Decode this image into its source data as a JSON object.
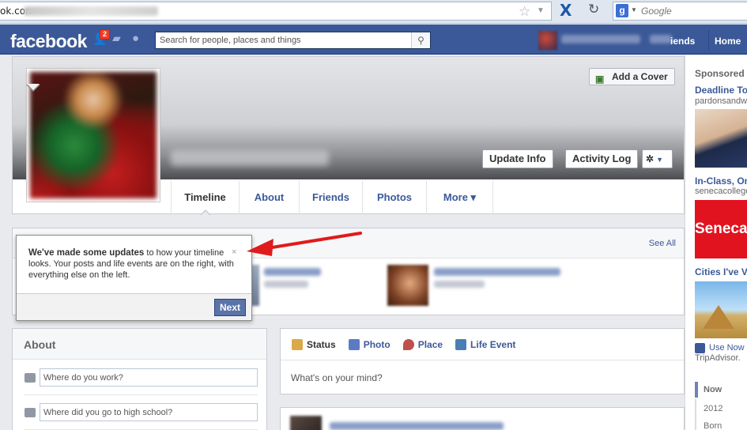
{
  "browser": {
    "url_prefix": "ok.con",
    "search_placeholder": "Google"
  },
  "fb_header": {
    "logo": "facebook",
    "friend_requests_count": "2",
    "search_placeholder": "Search for people, places and things",
    "nav_friends": "iends",
    "nav_home": "Home"
  },
  "profile": {
    "add_cover": "Add a Cover",
    "update_info": "Update Info",
    "activity_log": "Activity Log",
    "tabs": [
      {
        "label": "Timeline"
      },
      {
        "label": "About"
      },
      {
        "label": "Friends"
      },
      {
        "label": "Photos"
      },
      {
        "label": "More ▾"
      }
    ]
  },
  "friends_box": {
    "see_all": "See All"
  },
  "tooltip": {
    "bold": "We've made some updates",
    "text": " to how your timeline looks. Your posts and life events are on the right, with everything else on the left.",
    "close": "×",
    "next": "Next"
  },
  "about": {
    "title": "About",
    "work_placeholder": "Where do you work?",
    "school_placeholder": "Where did you go to high school?"
  },
  "composer": {
    "tabs": [
      {
        "label": "Status",
        "icon": "status-icon",
        "color": "#d9a94a"
      },
      {
        "label": "Photo",
        "icon": "photo-icon",
        "color": "#5b7bc4"
      },
      {
        "label": "Place",
        "icon": "place-icon",
        "color": "#c0504d"
      },
      {
        "label": "Life Event",
        "icon": "life-event-icon",
        "color": "#4a7fb5"
      }
    ],
    "placeholder": "What's on your mind?"
  },
  "right_column": {
    "sponsored": "Sponsored",
    "ads": [
      {
        "title": "Deadline To",
        "sub": "pardonsandwa"
      },
      {
        "title": "In-Class, On",
        "sub": "senecacollege",
        "image_text": "Seneca"
      },
      {
        "title": "Cities I've V"
      }
    ],
    "use_now": "Use Now",
    "tripadvisor": "TripAdvisor.",
    "scrubber": [
      "Now",
      "2012",
      "Born"
    ]
  },
  "colors": {
    "fb_blue": "#3b5998",
    "link": "#3b5998",
    "badge_red": "#f03d25"
  }
}
